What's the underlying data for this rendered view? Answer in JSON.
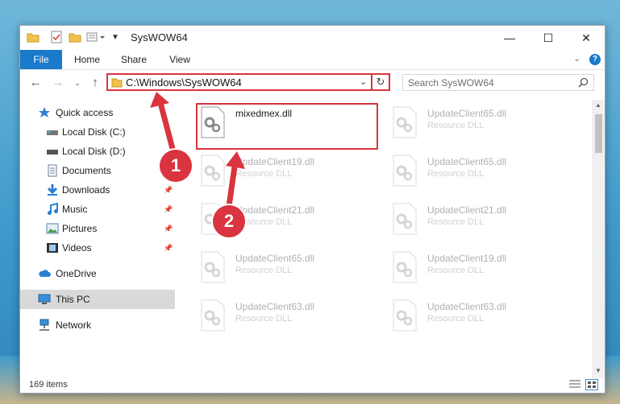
{
  "window": {
    "title": "SysWOW64"
  },
  "ribbon": {
    "tabs": [
      {
        "label": "File"
      },
      {
        "label": "Home"
      },
      {
        "label": "Share"
      },
      {
        "label": "View"
      }
    ]
  },
  "navbar": {
    "address": "C:\\Windows\\SysWOW64",
    "search_placeholder": "Search SysWOW64"
  },
  "navpane": {
    "items": [
      {
        "label": "Quick access",
        "icon": "star-icon"
      },
      {
        "label": "Local Disk (C:)",
        "icon": "drive-icon"
      },
      {
        "label": "Local Disk (D:)",
        "icon": "drive-icon"
      },
      {
        "label": "Documents",
        "icon": "documents-icon"
      },
      {
        "label": "Downloads",
        "icon": "downloads-icon",
        "pinned": true
      },
      {
        "label": "Music",
        "icon": "music-icon",
        "pinned": true
      },
      {
        "label": "Pictures",
        "icon": "pictures-icon",
        "pinned": true
      },
      {
        "label": "Videos",
        "icon": "videos-icon",
        "pinned": true
      },
      {
        "label": "OneDrive",
        "icon": "cloud-icon"
      },
      {
        "label": "This PC",
        "icon": "pc-icon",
        "selected": true
      },
      {
        "label": "Network",
        "icon": "network-icon"
      }
    ]
  },
  "files": [
    {
      "name": "mixedmex.dll",
      "type": ""
    },
    {
      "name": "UpdateClient65.dll",
      "type": "Resource DLL"
    },
    {
      "name": "UpdateClient19.dll",
      "type": "Resource DLL"
    },
    {
      "name": "UpdateClient65.dll",
      "type": "Resource DLL"
    },
    {
      "name": "UpdateClient21.dll",
      "type": "Resource DLL"
    },
    {
      "name": "UpdateClient21.dll",
      "type": "Resource DLL"
    },
    {
      "name": "UpdateClient65.dll",
      "type": "Resource DLL"
    },
    {
      "name": "UpdateClient19.dll",
      "type": "Resource DLL"
    },
    {
      "name": "UpdateClient63.dll",
      "type": "Resource DLL"
    },
    {
      "name": "UpdateClient63.dll",
      "type": "Resource DLL"
    }
  ],
  "status": {
    "item_count": "169 items"
  },
  "annotations": {
    "step1": "1",
    "step2": "2"
  },
  "colors": {
    "accent": "#1979ca",
    "highlight": "#d9343f"
  }
}
